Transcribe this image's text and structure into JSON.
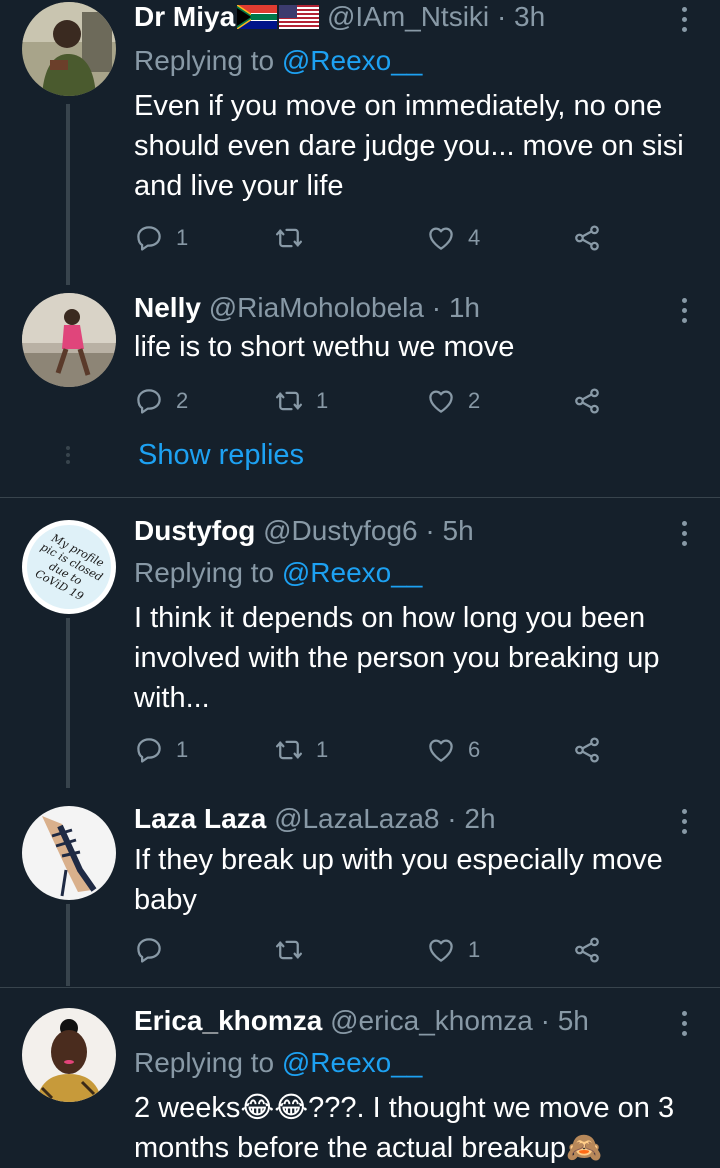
{
  "tweets": [
    {
      "name": "Dr Miya",
      "flags": [
        "south-africa-flag",
        "usa-flag"
      ],
      "handle": "@IAm_Ntsiki",
      "time": "3h",
      "replying_label": "Replying to",
      "replying_to": "@Reexo__",
      "text": "Even if you move on immediately, no one should even dare judge you... move on sisi and live your life",
      "replies": "1",
      "retweets": "",
      "likes": "4"
    },
    {
      "name": "Nelly",
      "handle": "@RiaMoholobela",
      "time": "1h",
      "text": "life is to short wethu we move",
      "replies": "2",
      "retweets": "1",
      "likes": "2",
      "show_replies": "Show replies"
    },
    {
      "name": "Dustyfog",
      "handle": "@Dustyfog6",
      "time": "5h",
      "replying_label": "Replying to",
      "replying_to": "@Reexo__",
      "text": "I think it depends on how long you been involved with the person you breaking up with...",
      "avatar_text": "My profile pic is closed due to CoViD 19",
      "replies": "1",
      "retweets": "1",
      "likes": "6"
    },
    {
      "name": "Laza Laza",
      "handle": "@LazaLaza8",
      "time": "2h",
      "text": "If they break up with you especially move baby",
      "replies": "",
      "retweets": "",
      "likes": "1"
    },
    {
      "name": "Erica_khomza",
      "handle": "@erica_khomza",
      "time": "5h",
      "replying_label": "Replying to",
      "replying_to": "@Reexo__",
      "text": "2 weeks😂😂???. I thought we move on 3 months before the actual breakup🙈"
    }
  ],
  "separator": "·",
  "colors": {
    "background": "#15202b",
    "secondary_text": "#8899a6",
    "link": "#1da1f2",
    "divider": "#38444d"
  },
  "icons": [
    "reply-icon",
    "retweet-icon",
    "like-icon",
    "share-icon",
    "more-icon"
  ]
}
